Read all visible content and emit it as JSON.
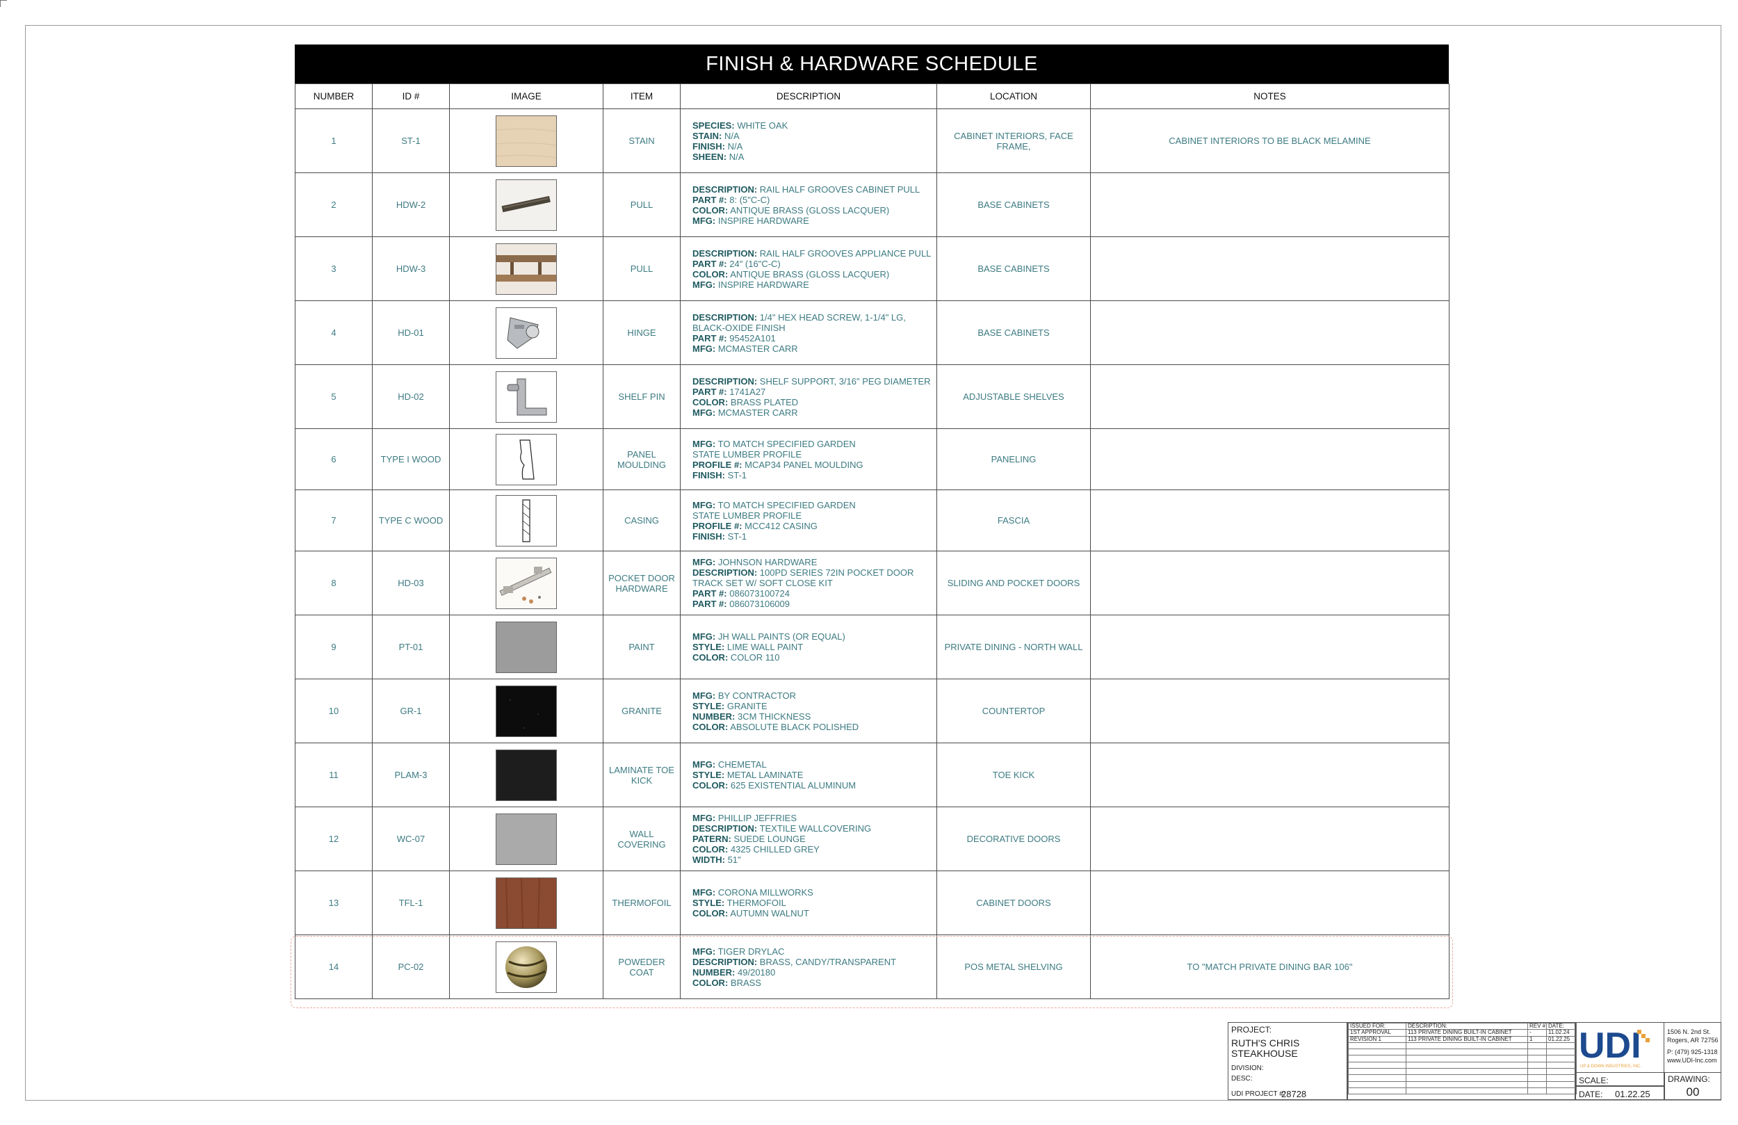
{
  "title": "FINISH & HARDWARE SCHEDULE",
  "columns": [
    "NUMBER",
    "ID #",
    "IMAGE",
    "ITEM",
    "DESCRIPTION",
    "LOCATION",
    "NOTES"
  ],
  "rows": [
    {
      "number": "1",
      "id": "ST-1",
      "item": "STAIN",
      "location": "CABINET INTERIORS, FACE FRAME,",
      "notes": "CABINET INTERIORS TO BE BLACK MELAMINE",
      "desc": [
        [
          "SPECIES:",
          "WHITE OAK"
        ],
        [
          "STAIN:",
          "N/A"
        ],
        [
          "FINISH:",
          "N/A"
        ],
        [
          "SHEEN:",
          "N/A"
        ]
      ]
    },
    {
      "number": "2",
      "id": "HDW-2",
      "item": "PULL",
      "location": "BASE CABINETS",
      "notes": "",
      "desc": [
        [
          "DESCRIPTION:",
          "RAIL HALF GROOVES CABINET PULL"
        ],
        [
          "PART #:",
          "8: (5\"C-C)"
        ],
        [
          "COLOR:",
          "ANTIQUE BRASS (GLOSS LACQUER)"
        ],
        [
          "MFG:",
          "INSPIRE HARDWARE"
        ]
      ]
    },
    {
      "number": "3",
      "id": "HDW-3",
      "item": "PULL",
      "location": "BASE CABINETS",
      "notes": "",
      "desc": [
        [
          "DESCRIPTION:",
          "RAIL HALF GROOVES APPLIANCE PULL"
        ],
        [
          "PART #:",
          "24\" (16\"C-C)"
        ],
        [
          "COLOR:",
          "ANTIQUE BRASS (GLOSS LACQUER)"
        ],
        [
          "MFG:",
          "INSPIRE HARDWARE"
        ]
      ]
    },
    {
      "number": "4",
      "id": "HD-01",
      "item": "HINGE",
      "location": "BASE CABINETS",
      "notes": "",
      "desc": [
        [
          "DESCRIPTION:",
          "1/4\" HEX HEAD SCREW, 1-1/4\" LG,"
        ],
        [
          "",
          "BLACK-OXIDE FINISH"
        ],
        [
          "PART #:",
          "95452A101"
        ],
        [
          "MFG:",
          "MCMASTER CARR"
        ]
      ]
    },
    {
      "number": "5",
      "id": "HD-02",
      "item": "SHELF PIN",
      "location": "ADJUSTABLE SHELVES",
      "notes": "",
      "desc": [
        [
          "DESCRIPTION:",
          " SHELF SUPPORT, 3/16\" PEG DIAMETER"
        ],
        [
          "PART #:",
          "1741A27"
        ],
        [
          "COLOR:",
          "BRASS PLATED"
        ],
        [
          "MFG:",
          "MCMASTER CARR"
        ]
      ]
    },
    {
      "number": "6",
      "id": "TYPE I WOOD",
      "item": "PANEL MOULDING",
      "location": "PANELING",
      "notes": "",
      "desc": [
        [
          "MFG:",
          " TO MATCH SPECIFIED GARDEN"
        ],
        [
          "",
          "STATE LUMBER PROFILE"
        ],
        [
          "PROFILE #:",
          "MCAP34 PANEL MOULDING"
        ],
        [
          "FINISH:",
          "ST-1"
        ]
      ]
    },
    {
      "number": "7",
      "id": "TYPE C WOOD",
      "item": "CASING",
      "location": "FASCIA",
      "notes": "",
      "desc": [
        [
          "MFG:",
          " TO MATCH SPECIFIED GARDEN"
        ],
        [
          "",
          "STATE LUMBER PROFILE"
        ],
        [
          "PROFILE #:",
          "MCC412 CASING"
        ],
        [
          "FINISH:",
          "ST-1"
        ]
      ]
    },
    {
      "number": "8",
      "id": "HD-03",
      "item": "POCKET DOOR HARDWARE",
      "location": "SLIDING AND POCKET DOORS",
      "notes": "",
      "desc": [
        [
          "MFG:",
          "JOHNSON HARDWARE"
        ],
        [
          "DESCRIPTION:",
          " 100PD SERIES 72IN POCKET DOOR"
        ],
        [
          "",
          "TRACK SET W/ SOFT CLOSE KIT"
        ],
        [
          "PART #:",
          "086073100724"
        ],
        [
          "PART #:",
          "086073106009"
        ]
      ]
    },
    {
      "number": "9",
      "id": "PT-01",
      "item": "PAINT",
      "location": "PRIVATE DINING - NORTH WALL",
      "notes": "",
      "desc": [
        [
          "MFG:",
          "JH WALL PAINTS (OR EQUAL)"
        ],
        [
          "STYLE:",
          "LIME WALL PAINT"
        ],
        [
          "COLOR:",
          "COLOR 110"
        ]
      ]
    },
    {
      "number": "10",
      "id": "GR-1",
      "item": "GRANITE",
      "location": "COUNTERTOP",
      "notes": "",
      "desc": [
        [
          "MFG:",
          "BY CONTRACTOR"
        ],
        [
          "STYLE:",
          "GRANITE"
        ],
        [
          "NUMBER:",
          "3CM THICKNESS"
        ],
        [
          "COLOR:",
          "ABSOLUTE BLACK POLISHED"
        ]
      ]
    },
    {
      "number": "11",
      "id": "PLAM-3",
      "item": "LAMINATE TOE KICK",
      "location": "TOE KICK",
      "notes": "",
      "desc": [
        [
          "MFG:",
          "CHEMETAL"
        ],
        [
          "STYLE:",
          "METAL LAMINATE"
        ],
        [
          "COLOR:",
          "625 EXISTENTIAL ALUMINUM"
        ]
      ]
    },
    {
      "number": "12",
      "id": "WC-07",
      "item": "WALL COVERING",
      "location": "DECORATIVE DOORS",
      "notes": "",
      "desc": [
        [
          "MFG:",
          "PHILLIP JEFFRIES"
        ],
        [
          "DESCRIPTION:",
          "TEXTILE WALLCOVERING"
        ],
        [
          "PATERN:",
          "SUEDE LOUNGE"
        ],
        [
          "COLOR:",
          "4325 CHILLED GREY"
        ],
        [
          "WIDTH:",
          "51\""
        ]
      ]
    },
    {
      "number": "13",
      "id": "TFL-1",
      "item": "THERMOFOIL",
      "location": "CABINET DOORS",
      "notes": "",
      "desc": [
        [
          "MFG:",
          "CORONA MILLWORKS"
        ],
        [
          "STYLE:",
          "THERMOFOIL"
        ],
        [
          "COLOR:",
          "AUTUMN WALNUT"
        ]
      ]
    },
    {
      "number": "14",
      "id": "PC-02",
      "item": "POWEDER COAT",
      "location": "POS METAL SHELVING",
      "notes": "TO \"MATCH PRIVATE DINING BAR 106\"",
      "desc": [
        [
          "MFG:",
          "TIGER DRYLAC"
        ],
        [
          "DESCRIPTION:",
          "BRASS, CANDY/TRANSPARENT"
        ],
        [
          "NUMBER:",
          "49/20180"
        ],
        [
          "COLOR:",
          "BRASS"
        ]
      ]
    }
  ],
  "swatches": [
    "wood-oak-swatch",
    "cabinet-pull-image",
    "appliance-pull-image",
    "hinge-image",
    "shelf-pin-image",
    "panel-moulding-profile",
    "casing-profile",
    "pocket-door-hardware-image",
    "paint-swatch",
    "granite-swatch",
    "laminate-swatch",
    "wallcovering-swatch",
    "thermofoil-swatch",
    "powder-coat-image"
  ],
  "swatch_colors": [
    "#e6d2b4",
    "#ffffff",
    "#ffffff",
    "#ffffff",
    "#ffffff",
    "#ffffff",
    "#ffffff",
    "#ffffff",
    "#9c9c9c",
    "#0c0c0c",
    "#1d1d1d",
    "#aaaaaa",
    "#8b4a32",
    "#ffffff"
  ],
  "titleblock": {
    "project_label": "PROJECT:",
    "project_name_1": "RUTH'S CHRIS",
    "project_name_2": "STEAKHOUSE",
    "division_label": "DIVISION:",
    "desc_label": "DESC:",
    "udi_project_label": "UDI PROJECT #:",
    "udi_project_number": "28728",
    "log_headers": [
      "ISSUED FOR:",
      "DESCRIPTION:",
      "REV #",
      "DATE:"
    ],
    "log_rows": [
      [
        "1ST APPROVAL",
        "113 PRIVATE DINING BUILT-IN CABINET",
        "-",
        "11.02.24"
      ],
      [
        "REVISION 1",
        "113 PRIVATE DINING BUILT-IN CABINET",
        "1",
        "01.22.25"
      ]
    ],
    "logo_text": "UDI",
    "logo_subtext": "UP & DOWN INDUSTRIES, INC.",
    "address_1": "1506 N. 2nd St.",
    "address_2": "Rogers, AR 72756",
    "phone": "P: (479) 925-1318",
    "website": "www.UDI-Inc.com",
    "scale_label": "SCALE:",
    "date_label": "DATE:",
    "date_value": "01.22.25",
    "drawing_label": "DRAWING:",
    "drawing_number": "00"
  },
  "colors": {
    "text_teal": "#3d7b82",
    "header_black": "#000000",
    "revision_cloud": "#e7a9a0",
    "logo_blue": "#1d4a8f",
    "logo_orange": "#e8a13b"
  }
}
